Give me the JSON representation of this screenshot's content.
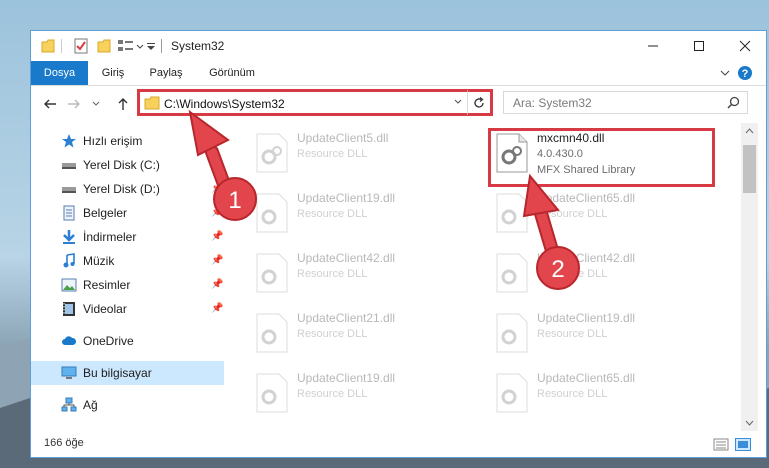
{
  "window": {
    "title": "System32",
    "minimize_label": "",
    "maximize_label": "",
    "close_label": ""
  },
  "ribbon": {
    "tabs": [
      "Dosya",
      "Giriş",
      "Paylaş",
      "Görünüm"
    ]
  },
  "navbar": {
    "address_value": "C:\\Windows\\System32",
    "search_placeholder": "Ara: System32"
  },
  "sidebar": {
    "items": [
      {
        "label": "Hızlı erişim",
        "icon": "star-icon"
      },
      {
        "label": "Yerel Disk (C:)",
        "icon": "drive-icon"
      },
      {
        "label": "Yerel Disk (D:)",
        "icon": "drive-icon"
      },
      {
        "label": "Belgeler",
        "icon": "documents-icon"
      },
      {
        "label": "İndirmeler",
        "icon": "download-icon"
      },
      {
        "label": "Müzik",
        "icon": "music-icon"
      },
      {
        "label": "Resimler",
        "icon": "pictures-icon"
      },
      {
        "label": "Videolar",
        "icon": "video-icon"
      },
      {
        "label": "OneDrive",
        "icon": "cloud-icon"
      },
      {
        "label": "Bu bilgisayar",
        "icon": "computer-icon"
      },
      {
        "label": "Ağ",
        "icon": "network-icon"
      }
    ]
  },
  "files": [
    {
      "name": "UpdateClient5.dll",
      "desc": "Resource DLL"
    },
    {
      "name": "mxcmn40.dll",
      "version": "4.0.430.0",
      "desc": "MFX Shared Library"
    },
    {
      "name": "UpdateClient19.dll",
      "desc": "Resource DLL"
    },
    {
      "name": "UpdateClient65.dll",
      "desc": "Resource DLL"
    },
    {
      "name": "UpdateClient42.dll",
      "desc": "Resource DLL"
    },
    {
      "name": "UpdateClient42.dll",
      "desc": "Resource DLL"
    },
    {
      "name": "UpdateClient21.dll",
      "desc": "Resource DLL"
    },
    {
      "name": "UpdateClient19.dll",
      "desc": "Resource DLL"
    },
    {
      "name": "UpdateClient19.dll",
      "desc": "Resource DLL"
    },
    {
      "name": "UpdateClient65.dll",
      "desc": "Resource DLL"
    }
  ],
  "status": {
    "item_count": "166 öğe"
  },
  "annotations": {
    "step1": "1",
    "step2": "2",
    "color": "#d73a42"
  }
}
